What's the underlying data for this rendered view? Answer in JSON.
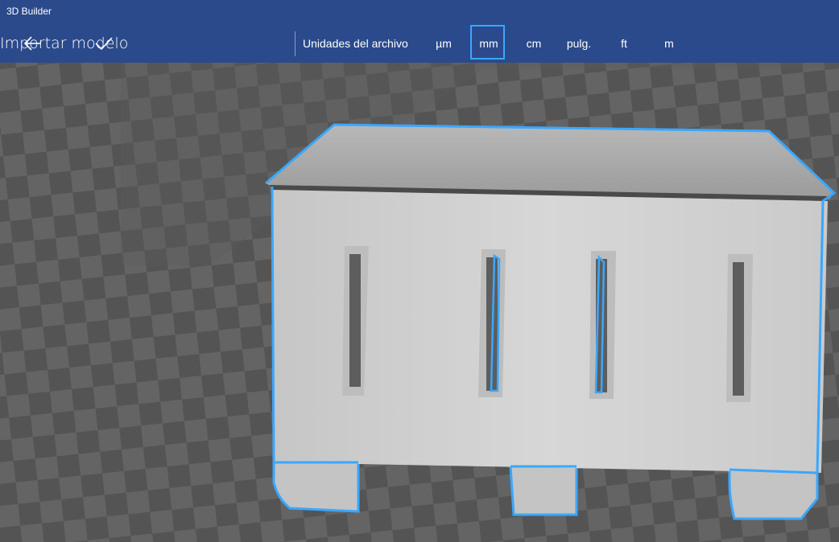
{
  "app": {
    "title": "3D Builder"
  },
  "toolbar": {
    "import_label": "Importar modelo",
    "units_label": "Unidades del archivo",
    "units": [
      "µm",
      "mm",
      "cm",
      "pulg.",
      "ft",
      "m"
    ],
    "selected_unit": "mm"
  },
  "colors": {
    "chrome": "#2b4a8c",
    "selection": "#3aa7ff",
    "model": "#d2d2d2"
  },
  "icons": {
    "back": "back-arrow-icon",
    "confirm": "checkmark-icon"
  }
}
